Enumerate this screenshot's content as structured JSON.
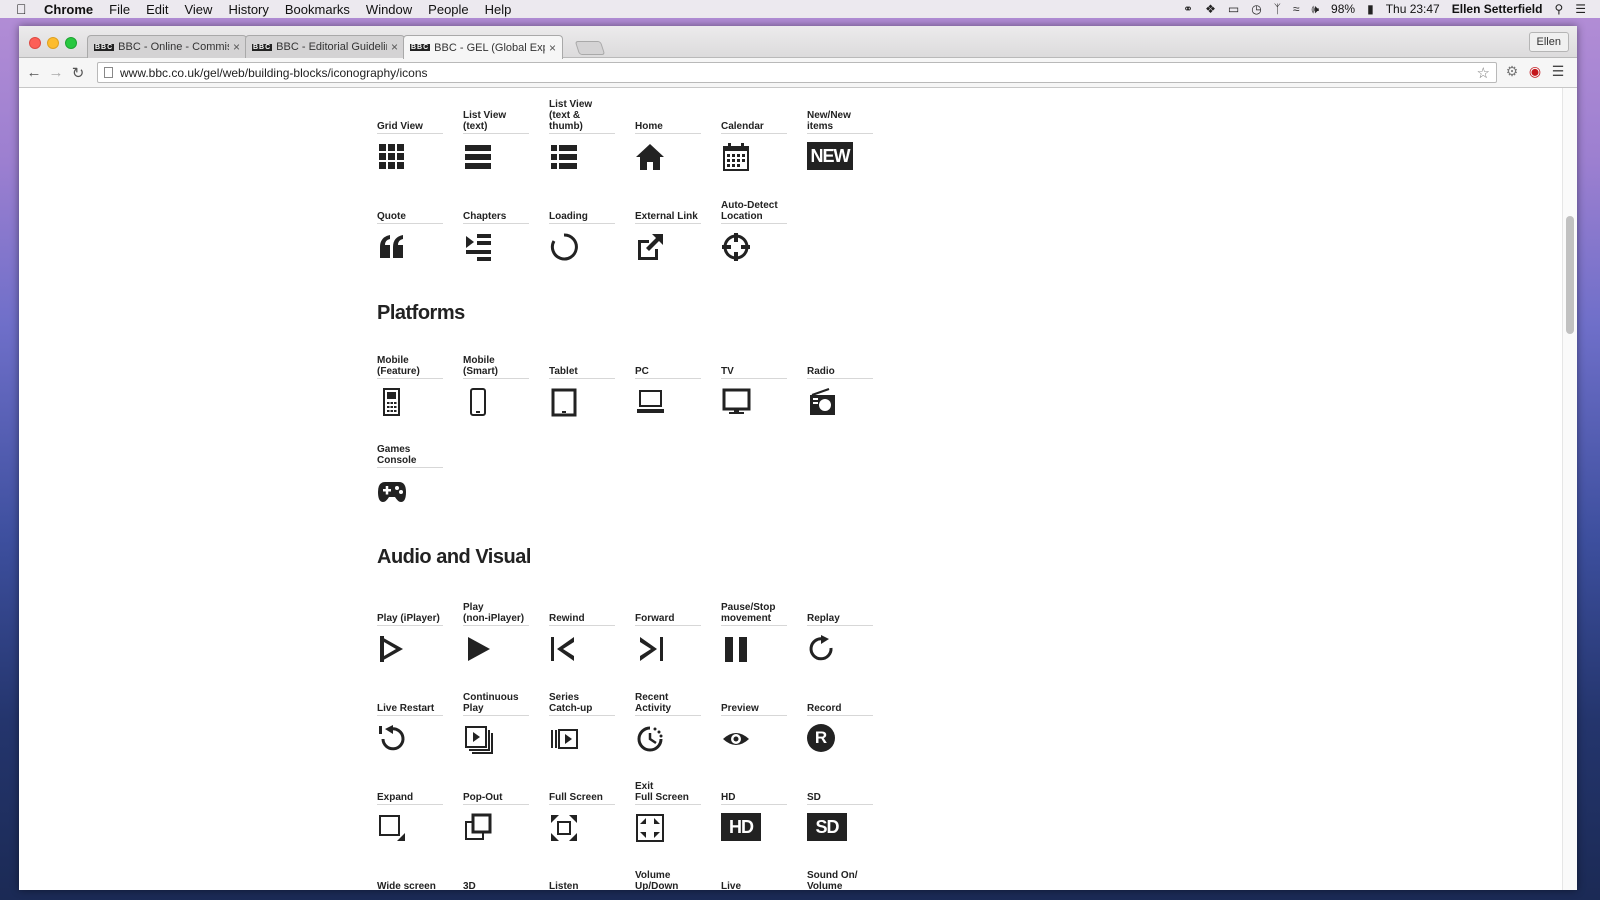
{
  "menubar": {
    "app": "Chrome",
    "items": [
      "File",
      "Edit",
      "View",
      "History",
      "Bookmarks",
      "Window",
      "People",
      "Help"
    ],
    "battery": "98%",
    "clock": "Thu 23:47",
    "user": "Ellen Setterfield"
  },
  "tabs": [
    {
      "favicon": "BBC",
      "title": "BBC - Online - Commissio"
    },
    {
      "favicon": "BBC",
      "title": "BBC - Editorial Guidelines"
    },
    {
      "favicon": "BBC",
      "title": "BBC - GEL (Global Experie"
    }
  ],
  "profile": "Ellen",
  "address": "www.bbc.co.uk/gel/web/building-blocks/iconography/icons",
  "sections": {
    "platforms": "Platforms",
    "audio_visual": "Audio and Visual"
  },
  "icons": {
    "r1": [
      "Grid View",
      "List View (text)",
      "List View\n(text & thumb)",
      "Home",
      "Calendar",
      "New/New items"
    ],
    "r2": [
      "Quote",
      "Chapters",
      "Loading",
      "External Link",
      "Auto-Detect\nLocation"
    ],
    "p1": [
      "Mobile\n(Feature)",
      "Mobile\n(Smart)",
      "Tablet",
      "PC",
      "TV",
      "Radio"
    ],
    "p2": [
      "Games\nConsole"
    ],
    "a1": [
      "Play (iPlayer)",
      "Play\n(non-iPlayer)",
      "Rewind",
      "Forward",
      "Pause/Stop\nmovement",
      "Replay"
    ],
    "a2": [
      "Live Restart",
      "Continuous\nPlay",
      "Series\nCatch-up",
      "Recent\nActivity",
      "Preview",
      "Record"
    ],
    "a3": [
      "Expand",
      "Pop-Out",
      "Full Screen",
      "Exit\nFull Screen",
      "HD",
      "SD"
    ],
    "a4": [
      "Wide screen",
      "3D",
      "Listen",
      "Volume\nUp/Down",
      "Live",
      "Sound On/\nVolume"
    ]
  },
  "badges": {
    "new": "NEW",
    "hd": "HD",
    "sd": "SD",
    "record": "R"
  }
}
